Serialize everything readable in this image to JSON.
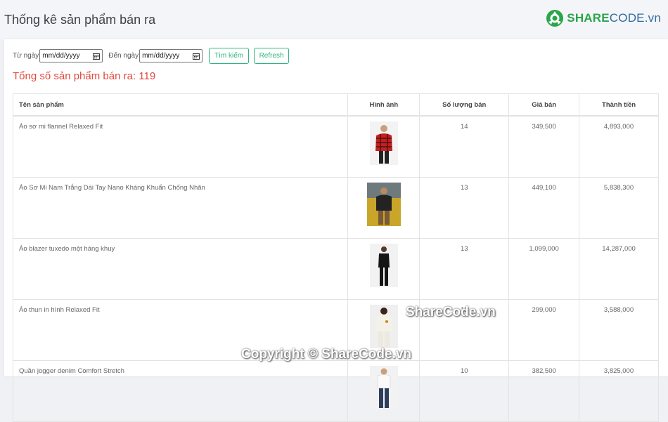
{
  "header": {
    "title": "Thống kê sản phẩm bán ra",
    "logo": {
      "share": "SHARE",
      "code": "CODE.vn"
    }
  },
  "filter": {
    "from_label": "Từ ngày",
    "from_placeholder": "mm/dd/yyyy",
    "to_label": "Đến ngày",
    "to_placeholder": "mm/dd/yyyy",
    "search_button": "Tìm kiếm",
    "refresh_button": "Refresh"
  },
  "summary": {
    "total_text": "Tổng số sản phẩm bán ra: 119"
  },
  "table": {
    "columns": [
      "Tên sản phẩm",
      "Hình ảnh",
      "Số lượng bán",
      "Giá bán",
      "Thành tiền"
    ],
    "rows": [
      {
        "name": "Áo sơ mi flannel Relaxed Fit",
        "image": "red-plaid-shirt",
        "qty": "14",
        "price": "349,500",
        "total": "4,893,000"
      },
      {
        "name": "Áo Sơ Mi Nam Trắng Dài Tay Nano Kháng Khuẩn Chống Nhăn",
        "image": "dark-shirt-on-yellow",
        "qty": "13",
        "price": "449,100",
        "total": "5,838,300"
      },
      {
        "name": "Áo blazer tuxedo một hàng khuy",
        "image": "black-tuxedo",
        "qty": "13",
        "price": "1,099,000",
        "total": "14,287,000"
      },
      {
        "name": "Áo thun in hình Relaxed Fit",
        "image": "white-tshirt",
        "qty": "12",
        "price": "299,000",
        "total": "3,588,000"
      },
      {
        "name": "Quần jogger denim Comfort Stretch",
        "image": "denim-jogger",
        "qty": "10",
        "price": "382,500",
        "total": "3,825,000"
      }
    ]
  },
  "watermarks": {
    "w1": "ShareCode.vn",
    "w2": "Copyright © ShareCode.vn"
  }
}
